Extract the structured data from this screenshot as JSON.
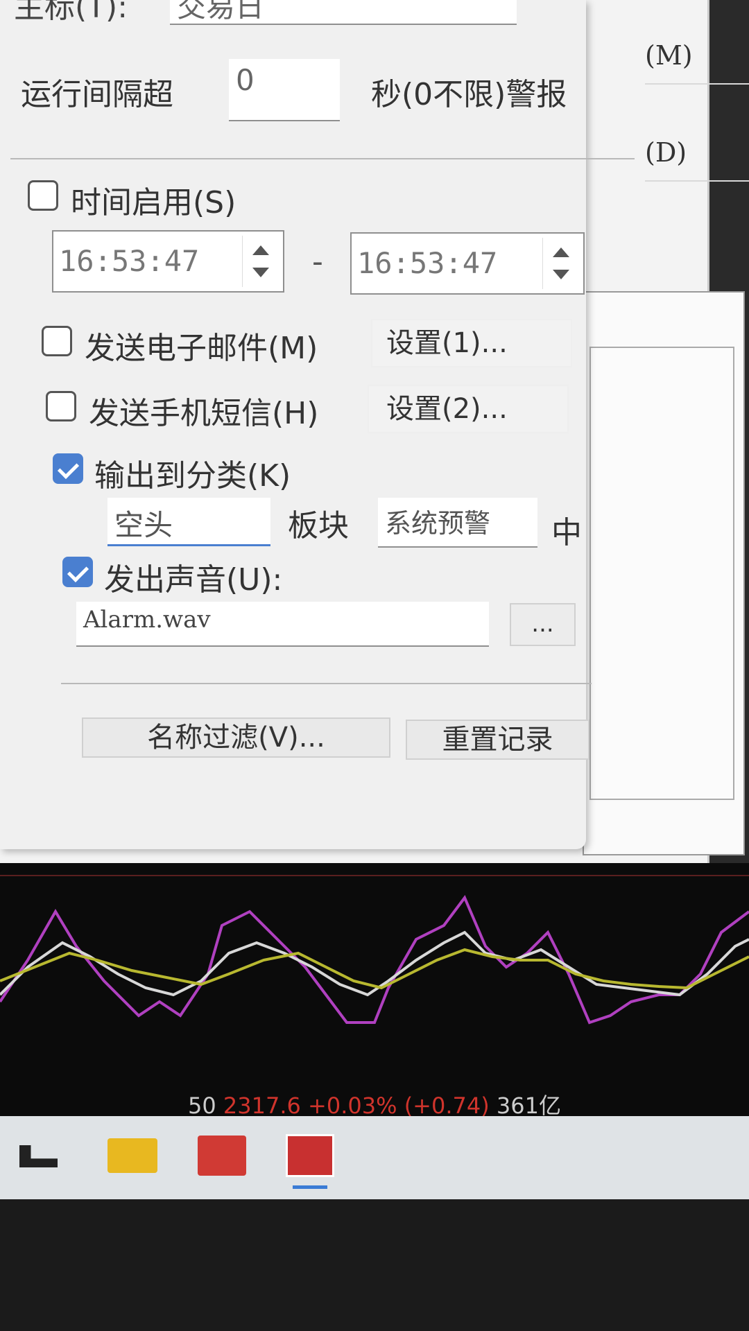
{
  "background_window": {
    "row_labels": [
      "(M)",
      "(D)"
    ]
  },
  "dialog": {
    "top_field_label": "主标(T):",
    "top_field_value": "交易日",
    "interval_label": "运行间隔超",
    "interval_value": "0",
    "interval_suffix": "秒(0不限)警报",
    "time_enable_label": "时间启用(S)",
    "time_start": "16:53:47",
    "time_dash": "-",
    "time_end": "16:53:47",
    "email_label": "发送电子邮件(M)",
    "email_settings": "设置(1)...",
    "sms_label": "发送手机短信(H)",
    "sms_settings": "设置(2)...",
    "category_label": "输出到分类(K)",
    "category_value": "空头",
    "board_label": "板块",
    "board_value": "系统预警",
    "board_suffix": "中",
    "sound_label": "发出声音(U):",
    "sound_file": "Alarm.wav",
    "browse_button": "...",
    "filter_button": "名称过滤(V)...",
    "reset_button": "重置记录"
  },
  "status": {
    "code": "50",
    "price": "2317.6",
    "change_pct": "+0.03%",
    "change_abs": "(+0.74)",
    "volume": "361亿"
  },
  "colors": {
    "accent": "#4a7fd0",
    "price_red": "#d0342c",
    "line_purple": "#b040c0",
    "line_white": "#d8d8d8",
    "line_yellow": "#b8b830"
  }
}
